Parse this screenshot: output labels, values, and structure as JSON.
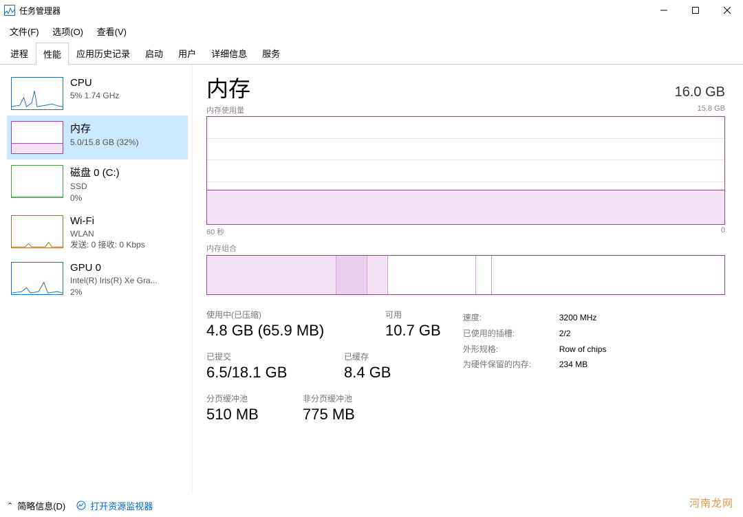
{
  "window": {
    "title": "任务管理器"
  },
  "menubar": [
    "文件(F)",
    "选项(O)",
    "查看(V)"
  ],
  "tabs": [
    "进程",
    "性能",
    "应用历史记录",
    "启动",
    "用户",
    "详细信息",
    "服务"
  ],
  "active_tab_index": 1,
  "sidebar": [
    {
      "name": "CPU",
      "sub": "5% 1.74 GHz",
      "kind": "cpu"
    },
    {
      "name": "内存",
      "sub": "5.0/15.8 GB (32%)",
      "kind": "mem",
      "selected": true
    },
    {
      "name": "磁盘 0 (C:)",
      "sub": "SSD\n0%",
      "kind": "disk"
    },
    {
      "name": "Wi-Fi",
      "sub": "WLAN\n发送: 0  接收: 0 Kbps",
      "kind": "wifi"
    },
    {
      "name": "GPU 0",
      "sub": "Intel(R) Iris(R) Xe Gra...\n2%",
      "kind": "gpu"
    }
  ],
  "main": {
    "title": "内存",
    "capacity": "16.0 GB",
    "usage_label": "内存使用量",
    "usage_max": "15.8 GB",
    "axis_left": "60 秒",
    "axis_right": "0",
    "composition_label": "内存组合",
    "stats_left": [
      [
        {
          "lbl": "使用中(已压缩)",
          "val": "4.8 GB (65.9 MB)"
        },
        {
          "lbl": "可用",
          "val": "10.7 GB"
        }
      ],
      [
        {
          "lbl": "已提交",
          "val": "6.5/18.1 GB"
        },
        {
          "lbl": "已缓存",
          "val": "8.4 GB"
        }
      ],
      [
        {
          "lbl": "分页缓冲池",
          "val": "510 MB"
        },
        {
          "lbl": "非分页缓冲池",
          "val": "775 MB"
        }
      ]
    ],
    "specs": [
      {
        "k": "速度:",
        "v": "3200 MHz"
      },
      {
        "k": "已使用的插槽:",
        "v": "2/2"
      },
      {
        "k": "外形规格:",
        "v": "Row of chips"
      },
      {
        "k": "为硬件保留的内存:",
        "v": "234 MB"
      }
    ]
  },
  "chart_data": {
    "type": "area",
    "title": "内存使用量",
    "xlabel": "60 秒 → 0",
    "ylabel": "GB",
    "ylim": [
      0,
      15.8
    ],
    "series": [
      {
        "name": "使用中",
        "approx_percent": 32,
        "approx_gb": 5.0
      }
    ],
    "composition_segments_percent": [
      25,
      6,
      4,
      17,
      3,
      45
    ]
  },
  "statusbar": {
    "brief": "简略信息(D)",
    "monitor": "打开资源监视器"
  },
  "watermark": "河南龙网"
}
